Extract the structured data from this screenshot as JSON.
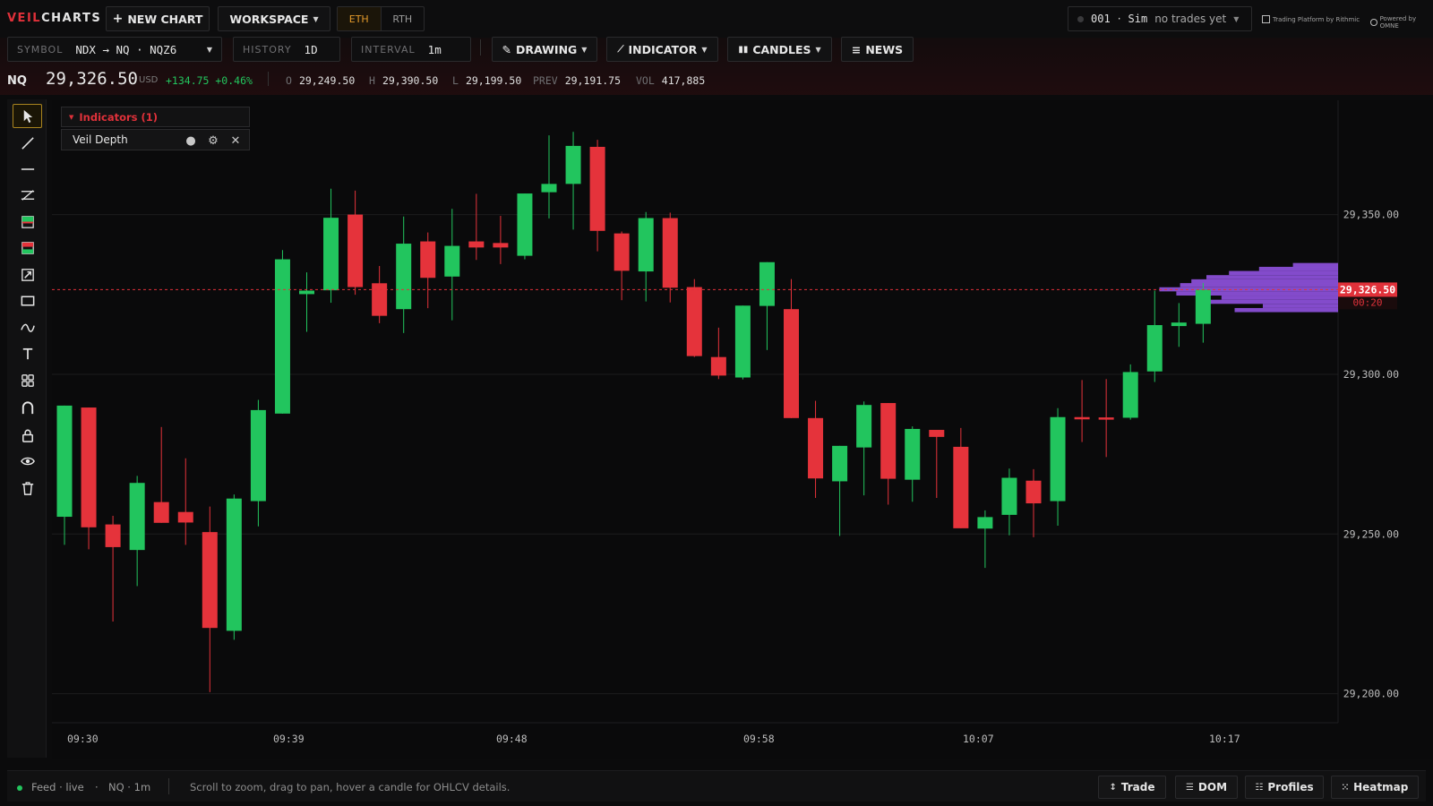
{
  "app": {
    "logo_part1": "VEIL",
    "logo_part2": "CHARTS"
  },
  "topbar": {
    "new_chart": "NEW CHART",
    "workspace": "WORKSPACE",
    "session_eth": "ETH",
    "session_rth": "RTH",
    "account_id": "001",
    "account_sep": "·",
    "account_mode": "Sim",
    "account_status": "no trades yet",
    "brand_rithmic": "Trading Platform by Rithmic",
    "brand_omne": "Powered by OMNE"
  },
  "toolbar": {
    "symbol_label": "SYMBOL",
    "symbol_value": "NDX → NQ · NQZ6",
    "history_label": "HISTORY",
    "history_value": "1D",
    "interval_label": "INTERVAL",
    "interval_value": "1m",
    "drawing": "DRAWING",
    "indicator": "INDICATOR",
    "candles": "CANDLES",
    "news": "NEWS"
  },
  "quote": {
    "symbol": "NQ",
    "last": "29,326.50",
    "currency": "USD",
    "change": "+134.75 +0.46%",
    "open_label": "O",
    "open": "29,249.50",
    "high_label": "H",
    "high": "29,390.50",
    "low_label": "L",
    "low": "29,199.50",
    "prev_label": "PREV",
    "prev": "29,191.75",
    "vol_label": "VOL",
    "vol": "417,885"
  },
  "tools": [
    "cursor-icon",
    "trend-line-icon",
    "horizontal-line-icon",
    "parallel-channel-icon",
    "long-position-icon",
    "short-position-icon",
    "measure-icon",
    "rectangle-icon",
    "brush-icon",
    "text-icon",
    "patterns-icon",
    "magnet-icon",
    "lock-icon",
    "eye-icon",
    "trash-icon"
  ],
  "indicators": {
    "header": "Indicators (1)",
    "items": [
      {
        "name": "Veil Depth"
      }
    ]
  },
  "colors": {
    "up": "#22c55e",
    "down": "#e5333b",
    "profile": "#8a4fd6",
    "last_line": "#e0313a"
  },
  "chart_data": {
    "type": "candlestick",
    "symbol": "NQ",
    "interval": "1m",
    "y_ticks": [
      29350,
      29300,
      29250,
      29200
    ],
    "y_tick_labels": [
      "29,350.00",
      "29,300.00",
      "29,250.00",
      "29,200.00"
    ],
    "x_tick_labels": [
      "09:30",
      "09:39",
      "09:48",
      "09:58",
      "10:07",
      "10:17"
    ],
    "last_price": 29326.5,
    "last_price_label": "29,326.50",
    "countdown": "00:20",
    "candles": [
      {
        "o": 29255.4,
        "h": 29287.6,
        "l": 29246.6,
        "c": 29290.2
      },
      {
        "o": 29289.6,
        "h": 29289.6,
        "l": 29245.2,
        "c": 29252.1
      },
      {
        "o": 29253.0,
        "h": 29255.7,
        "l": 29222.6,
        "c": 29245.9
      },
      {
        "o": 29245.0,
        "h": 29268.2,
        "l": 29233.7,
        "c": 29266.0
      },
      {
        "o": 29260.0,
        "h": 29283.5,
        "l": 29255.0,
        "c": 29253.5
      },
      {
        "o": 29256.9,
        "h": 29273.7,
        "l": 29246.6,
        "c": 29253.6
      },
      {
        "o": 29250.6,
        "h": 29258.6,
        "l": 29200.5,
        "c": 29220.6
      },
      {
        "o": 29219.7,
        "h": 29262.4,
        "l": 29216.9,
        "c": 29261.1
      },
      {
        "o": 29260.3,
        "h": 29292.0,
        "l": 29252.4,
        "c": 29288.8
      },
      {
        "o": 29287.7,
        "h": 29338.9,
        "l": 29287.7,
        "c": 29336.0
      },
      {
        "o": 29325.1,
        "h": 29331.9,
        "l": 29313.3,
        "c": 29326.2
      },
      {
        "o": 29326.3,
        "h": 29358.1,
        "l": 29322.4,
        "c": 29349.0
      },
      {
        "o": 29350.0,
        "h": 29357.5,
        "l": 29324.9,
        "c": 29327.3
      },
      {
        "o": 29328.5,
        "h": 29333.9,
        "l": 29316.0,
        "c": 29318.3
      },
      {
        "o": 29320.4,
        "h": 29349.4,
        "l": 29312.9,
        "c": 29340.9
      },
      {
        "o": 29341.6,
        "h": 29344.4,
        "l": 29320.7,
        "c": 29330.2
      },
      {
        "o": 29330.6,
        "h": 29351.8,
        "l": 29316.9,
        "c": 29340.2
      },
      {
        "o": 29341.6,
        "h": 29356.5,
        "l": 29335.8,
        "c": 29339.7
      },
      {
        "o": 29341.1,
        "h": 29349.6,
        "l": 29334.5,
        "c": 29339.7
      },
      {
        "o": 29337.1,
        "h": 29352.1,
        "l": 29336.0,
        "c": 29356.6
      },
      {
        "o": 29357.0,
        "h": 29374.8,
        "l": 29348.8,
        "c": 29359.6
      },
      {
        "o": 29359.6,
        "h": 29375.9,
        "l": 29345.3,
        "c": 29371.5
      },
      {
        "o": 29371.2,
        "h": 29373.4,
        "l": 29338.5,
        "c": 29344.9
      },
      {
        "o": 29344.1,
        "h": 29344.7,
        "l": 29323.2,
        "c": 29332.4
      },
      {
        "o": 29332.2,
        "h": 29350.8,
        "l": 29322.8,
        "c": 29348.9
      },
      {
        "o": 29348.9,
        "h": 29350.6,
        "l": 29322.5,
        "c": 29327.1
      },
      {
        "o": 29327.3,
        "h": 29329.8,
        "l": 29305.4,
        "c": 29305.7
      },
      {
        "o": 29305.4,
        "h": 29314.6,
        "l": 29298.5,
        "c": 29299.6
      },
      {
        "o": 29299.0,
        "h": 29316.4,
        "l": 29298.4,
        "c": 29321.5
      },
      {
        "o": 29321.4,
        "h": 29334.4,
        "l": 29307.6,
        "c": 29335.1
      },
      {
        "o": 29320.4,
        "h": 29329.8,
        "l": 29307.6,
        "c": 29286.3
      },
      {
        "o": 29286.3,
        "h": 29291.7,
        "l": 29261.3,
        "c": 29267.4
      },
      {
        "o": 29266.5,
        "h": 29276.9,
        "l": 29249.4,
        "c": 29277.6
      },
      {
        "o": 29277.1,
        "h": 29291.5,
        "l": 29262.1,
        "c": 29290.4
      },
      {
        "o": 29291.0,
        "h": 29291.0,
        "l": 29259.2,
        "c": 29267.3
      },
      {
        "o": 29267.0,
        "h": 29283.7,
        "l": 29260.1,
        "c": 29282.9
      },
      {
        "o": 29282.6,
        "h": 29282.4,
        "l": 29261.3,
        "c": 29280.4
      },
      {
        "o": 29277.3,
        "h": 29283.2,
        "l": 29251.9,
        "c": 29251.8
      },
      {
        "o": 29251.7,
        "h": 29257.4,
        "l": 29239.4,
        "c": 29255.3
      },
      {
        "o": 29256.0,
        "h": 29270.5,
        "l": 29249.6,
        "c": 29267.6
      },
      {
        "o": 29266.7,
        "h": 29270.3,
        "l": 29249.0,
        "c": 29259.6
      },
      {
        "o": 29260.3,
        "h": 29289.4,
        "l": 29252.6,
        "c": 29286.6
      },
      {
        "o": 29286.6,
        "h": 29298.2,
        "l": 29278.8,
        "c": 29286.4
      },
      {
        "o": 29286.5,
        "h": 29298.5,
        "l": 29274.1,
        "c": 29286.4
      },
      {
        "o": 29286.4,
        "h": 29303.1,
        "l": 29285.8,
        "c": 29300.7
      },
      {
        "o": 29300.9,
        "h": 29326.2,
        "l": 29297.6,
        "c": 29315.4
      },
      {
        "o": 29315.1,
        "h": 29322.3,
        "l": 29308.6,
        "c": 29316.2
      },
      {
        "o": 29315.8,
        "h": 29328.6,
        "l": 29309.9,
        "c": 29326.5
      }
    ],
    "volume_profile": [
      {
        "price": 29334.2,
        "width": 0.24
      },
      {
        "price": 29333.0,
        "width": 0.42
      },
      {
        "price": 29331.7,
        "width": 0.58
      },
      {
        "price": 29330.4,
        "width": 0.7
      },
      {
        "price": 29329.1,
        "width": 0.78
      },
      {
        "price": 29327.9,
        "width": 0.84
      },
      {
        "price": 29326.6,
        "width": 0.95
      },
      {
        "price": 29325.3,
        "width": 0.86
      },
      {
        "price": 29324.0,
        "width": 0.62
      },
      {
        "price": 29322.7,
        "width": 0.72
      },
      {
        "price": 29321.4,
        "width": 0.4
      },
      {
        "price": 29320.1,
        "width": 0.55
      }
    ]
  },
  "status": {
    "feed": "Feed · live",
    "dot": "·",
    "instrument": "NQ · 1m",
    "hint": "Scroll to zoom, drag to pan, hover a candle for OHLCV details.",
    "trade": "Trade",
    "dom": "DOM",
    "profiles": "Profiles",
    "heatmap": "Heatmap"
  }
}
